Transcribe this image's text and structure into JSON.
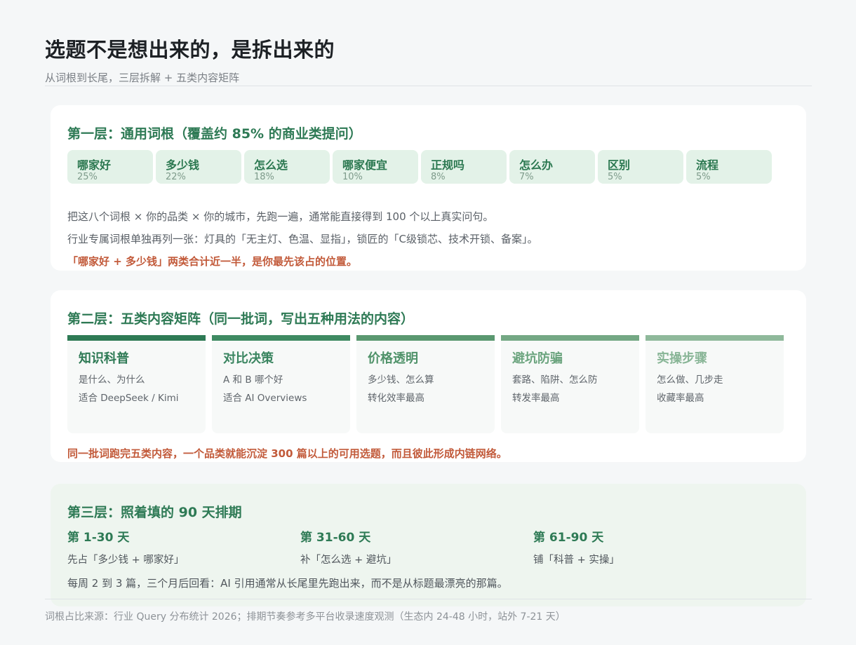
{
  "header": {
    "title": "选题不是想出来的，是拆出来的",
    "subtitle": "从词根到长尾，三层拆解 + 五类内容矩阵"
  },
  "layer1": {
    "title": "第一层：通用词根（覆盖约 85% 的商业类提问）",
    "chips": [
      {
        "label": "哪家好",
        "pct": "25%"
      },
      {
        "label": "多少钱",
        "pct": "22%"
      },
      {
        "label": "怎么选",
        "pct": "18%"
      },
      {
        "label": "哪家便宜",
        "pct": "10%"
      },
      {
        "label": "正规吗",
        "pct": "8%"
      },
      {
        "label": "怎么办",
        "pct": "7%"
      },
      {
        "label": "区别",
        "pct": "5%"
      },
      {
        "label": "流程",
        "pct": "5%"
      }
    ],
    "para1": "把这八个词根 × 你的品类 × 你的城市，先跑一遍，通常能直接得到 100 个以上真实问句。",
    "para2": "行业专属词根单独再列一张：灯具的「无主灯、色温、显指」，锁匠的「C级锁芯、技术开锁、备案」。",
    "highlight": "「哪家好 + 多少钱」两类合计近一半，是你最先该占的位置。"
  },
  "layer2": {
    "title": "第二层：五类内容矩阵（同一批词，写出五种用法的内容）",
    "columns": [
      {
        "title": "知识科普",
        "line1": "是什么、为什么",
        "line2": "适合 DeepSeek / Kimi",
        "bar_color": "#2e7a55",
        "title_color": "#2e7a55"
      },
      {
        "title": "对比决策",
        "line1": "A 和 B 哪个好",
        "line2": "适合 AI Overviews",
        "bar_color": "#3f8a62",
        "title_color": "#3a8560"
      },
      {
        "title": "价格透明",
        "line1": "多少钱、怎么算",
        "line2": "转化效率最高",
        "bar_color": "#5a9870",
        "title_color": "#4f9269"
      },
      {
        "title": "避坑防骗",
        "line1": "套路、陷阱、怎么防",
        "line2": "转发率最高",
        "bar_color": "#74a884",
        "title_color": "#6ba47e"
      },
      {
        "title": "实操步骤",
        "line1": "怎么做、几步走",
        "line2": "收藏率最高",
        "bar_color": "#8fb99b",
        "title_color": "#88b596"
      }
    ],
    "note": "同一批词跑完五类内容，一个品类就能沉淀 300 篇以上的可用选题，而且彼此形成内链网络。"
  },
  "layer3": {
    "title": "第三层：照着填的 90 天排期",
    "phases": [
      {
        "title": "第 1-30 天",
        "desc": "先占「多少钱 + 哪家好」"
      },
      {
        "title": "第 31-60 天",
        "desc": "补「怎么选 + 避坑」"
      },
      {
        "title": "第 61-90 天",
        "desc": "铺「科普 + 实操」"
      }
    ],
    "note": "每周 2 到 3 篇，三个月后回看：AI 引用通常从长尾里先跑出来，而不是从标题最漂亮的那篇。"
  },
  "footer": {
    "text": "词根占比来源：行业 Query 分布统计 2026；排期节奏参考多平台收录速度观测（生态内 24-48 小时，站外 7-21 天）"
  }
}
